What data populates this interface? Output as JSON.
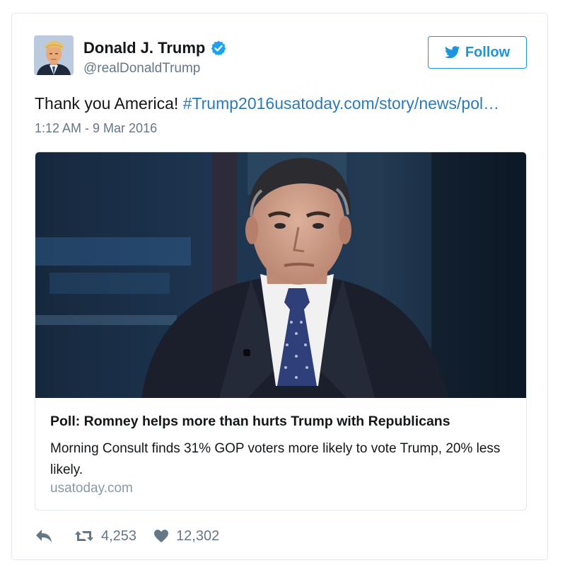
{
  "user": {
    "display_name": "Donald J. Trump",
    "screen_name": "@realDonaldTrump",
    "verified_icon": "verified-badge-icon",
    "avatar_icon": "avatar"
  },
  "follow_button": {
    "label": "Follow",
    "icon": "twitter-bird-icon"
  },
  "tweet": {
    "text": "Thank you America! ",
    "link_text": "#Trump2016usatoday.com/story/news/pol…",
    "timestamp": "1:12 AM - 9 Mar 2016"
  },
  "card": {
    "title": "Poll: Romney helps more than hurts Trump with Republicans",
    "description": "Morning Consult finds 31% GOP voters more likely to vote Trump, 20% less likely.",
    "domain": "usatoday.com"
  },
  "actions": {
    "reply_icon": "reply-icon",
    "retweet_icon": "retweet-icon",
    "retweet_count": "4,253",
    "like_icon": "heart-icon",
    "like_count": "12,302"
  },
  "colors": {
    "link": "#2b7bb9",
    "follow": "#1b95e0",
    "muted": "#657786",
    "border": "#e1e8ed"
  }
}
